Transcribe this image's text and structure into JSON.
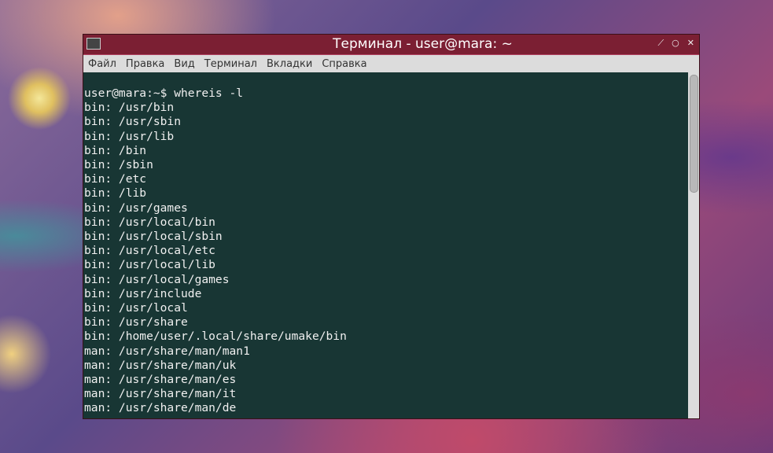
{
  "window": {
    "title": "Терминал - user@mara: ~",
    "controls": [
      "minimize-icon",
      "maximize-icon",
      "close-icon"
    ]
  },
  "menu": [
    "Файл",
    "Правка",
    "Вид",
    "Терминал",
    "Вкладки",
    "Справка"
  ],
  "terminal": {
    "lines": [
      "user@mara:~$ whereis -l",
      "bin: /usr/bin",
      "bin: /usr/sbin",
      "bin: /usr/lib",
      "bin: /bin",
      "bin: /sbin",
      "bin: /etc",
      "bin: /lib",
      "bin: /usr/games",
      "bin: /usr/local/bin",
      "bin: /usr/local/sbin",
      "bin: /usr/local/etc",
      "bin: /usr/local/lib",
      "bin: /usr/local/games",
      "bin: /usr/include",
      "bin: /usr/local",
      "bin: /usr/share",
      "bin: /home/user/.local/share/umake/bin",
      "man: /usr/share/man/man1",
      "man: /usr/share/man/uk",
      "man: /usr/share/man/es",
      "man: /usr/share/man/it",
      "man: /usr/share/man/de"
    ]
  }
}
